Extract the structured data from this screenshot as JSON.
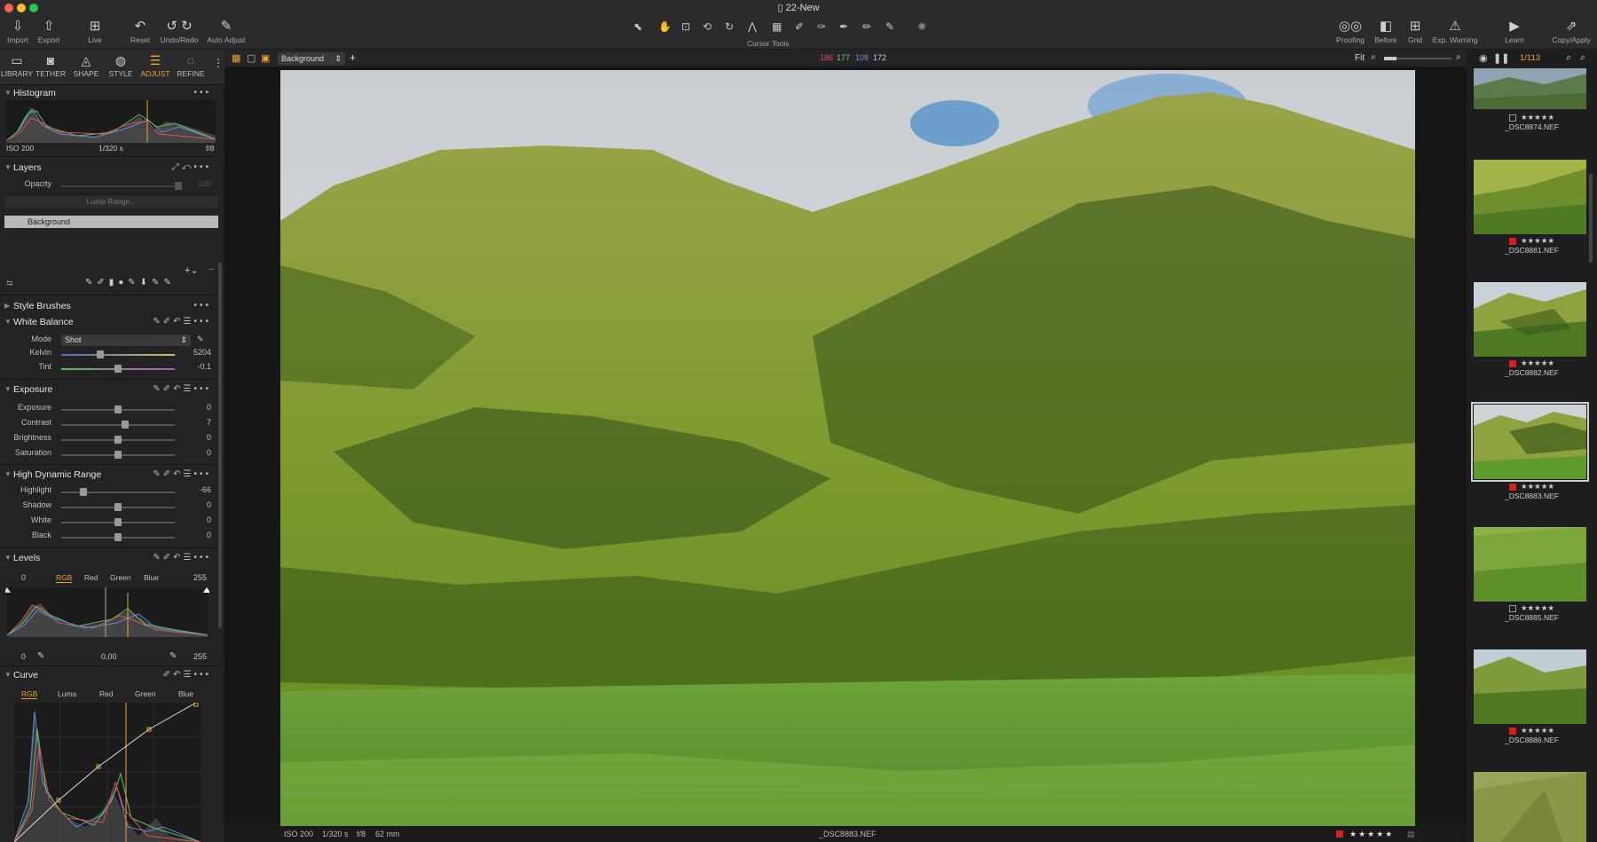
{
  "window": {
    "title": "22-New",
    "traffic_colors": [
      "#fe5f57",
      "#febc2e",
      "#28c840"
    ]
  },
  "toolbar": {
    "left": [
      {
        "label": "Import",
        "icon": "import-icon"
      },
      {
        "label": "Export",
        "icon": "export-icon"
      },
      {
        "label": "Live",
        "icon": "live-icon"
      },
      {
        "label": "Reset",
        "icon": "reset-icon"
      },
      {
        "label": "Undo/Redo",
        "icon": "undo-icon"
      },
      {
        "label": "Auto Adjust",
        "icon": "auto-adjust-icon"
      }
    ],
    "cursor_tools_label": "Cursor Tools",
    "right": [
      {
        "label": "Proofing",
        "icon": "proofing-icon"
      },
      {
        "label": "Before",
        "icon": "before-icon"
      },
      {
        "label": "Grid",
        "icon": "grid-icon"
      },
      {
        "label": "Exp. Warning",
        "icon": "warning-icon"
      },
      {
        "label": "Learn",
        "icon": "learn-icon"
      },
      {
        "label": "Copy/Apply",
        "icon": "copy-apply-icon"
      }
    ]
  },
  "tabs": [
    {
      "label": "LIBRARY"
    },
    {
      "label": "TETHER"
    },
    {
      "label": "SHAPE"
    },
    {
      "label": "STYLE"
    },
    {
      "label": "ADJUST"
    },
    {
      "label": "REFINE"
    }
  ],
  "active_tab": "ADJUST",
  "subbar": {
    "layer_select": "Background",
    "rgb": {
      "r": "186",
      "g": "177",
      "b": "108",
      "l": "172"
    },
    "zoom": "Fit",
    "page": "1/113"
  },
  "histogram": {
    "title": "Histogram",
    "iso": "ISO 200",
    "shutter": "1/320 s",
    "aperture": "f/8"
  },
  "layers": {
    "title": "Layers",
    "opacity_label": "Opacity",
    "opacity_value": "100",
    "luma_button": "Luma Range...",
    "layer_name": "Background"
  },
  "style_brushes": {
    "title": "Style Brushes"
  },
  "white_balance": {
    "title": "White Balance",
    "mode_label": "Mode",
    "mode_value": "Shot",
    "kelvin_label": "Kelvin",
    "kelvin_value": "5204",
    "tint_label": "Tint",
    "tint_value": "-0.1"
  },
  "exposure": {
    "title": "Exposure",
    "rows": [
      {
        "label": "Exposure",
        "value": "0"
      },
      {
        "label": "Contrast",
        "value": "7"
      },
      {
        "label": "Brightness",
        "value": "0"
      },
      {
        "label": "Saturation",
        "value": "0"
      }
    ]
  },
  "hdr": {
    "title": "High Dynamic Range",
    "rows": [
      {
        "label": "Highlight",
        "value": "-66"
      },
      {
        "label": "Shadow",
        "value": "0"
      },
      {
        "label": "White",
        "value": "0"
      },
      {
        "label": "Black",
        "value": "0"
      }
    ]
  },
  "levels": {
    "title": "Levels",
    "channels": [
      "RGB",
      "Red",
      "Green",
      "Blue"
    ],
    "in_low": "0",
    "in_high": "255",
    "out_low": "0",
    "mid": "0,00",
    "out_high": "255"
  },
  "curve": {
    "title": "Curve",
    "channels": [
      "RGB",
      "Luma",
      "Red",
      "Green",
      "Blue"
    ]
  },
  "status": {
    "iso": "ISO 200",
    "shutter": "1/320 s",
    "aperture": "f/8",
    "focal": "62 mm",
    "filename": "_DSC8883.NEF"
  },
  "filmstrip": [
    {
      "name": "_DSC8874.NEF",
      "flag": "none"
    },
    {
      "name": "_DSC8881.NEF",
      "flag": "red"
    },
    {
      "name": "_DSC8882.NEF",
      "flag": "red"
    },
    {
      "name": "_DSC8883.NEF",
      "flag": "red",
      "selected": true
    },
    {
      "name": "_DSC8885.NEF",
      "flag": "none"
    },
    {
      "name": "_DSC8886.NEF",
      "flag": "red"
    },
    {
      "name": "",
      "flag": "none"
    }
  ],
  "stars": "★★★★★",
  "colors": {
    "accent": "#f0a030",
    "red_flag": "#d42020"
  }
}
